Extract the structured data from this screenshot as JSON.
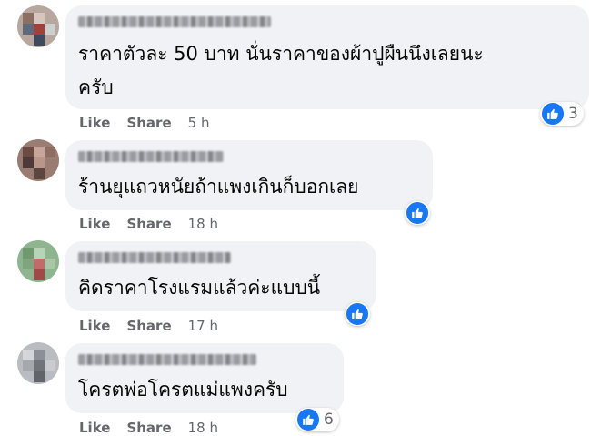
{
  "comments": [
    {
      "text_lines": [
        "ราคาตัวละ 50 บาท นั่นราคาของผ้าปูผืนนึงเลยนะ",
        "ครับ"
      ],
      "actions": {
        "like": "Like",
        "share": "Share",
        "time": "5 h"
      },
      "reaction": {
        "icon": "thumbs-up-icon",
        "count": "3"
      }
    },
    {
      "text_lines": [
        "ร้านยุแถวหนัยถ้าแพงเกินก็บอกเลย"
      ],
      "actions": {
        "like": "Like",
        "share": "Share",
        "time": "18 h"
      },
      "reaction": {
        "icon": "thumbs-up-icon",
        "count": ""
      }
    },
    {
      "text_lines": [
        "คิดราคาโรงแรมแล้วค่ะแบบนี้"
      ],
      "actions": {
        "like": "Like",
        "share": "Share",
        "time": "17 h"
      },
      "reaction": {
        "icon": "thumbs-up-icon",
        "count": ""
      }
    },
    {
      "text_lines": [
        "โครตพ่อโครตแม่แพงครับ"
      ],
      "actions": {
        "like": "Like",
        "share": "Share",
        "time": "18 h"
      },
      "reaction": {
        "icon": "thumbs-up-icon",
        "count": "6"
      }
    }
  ],
  "colors": {
    "bubble": "#f0f2f5",
    "text": "#050505",
    "secondary": "#65676b",
    "like_blue": "#1877f2"
  }
}
